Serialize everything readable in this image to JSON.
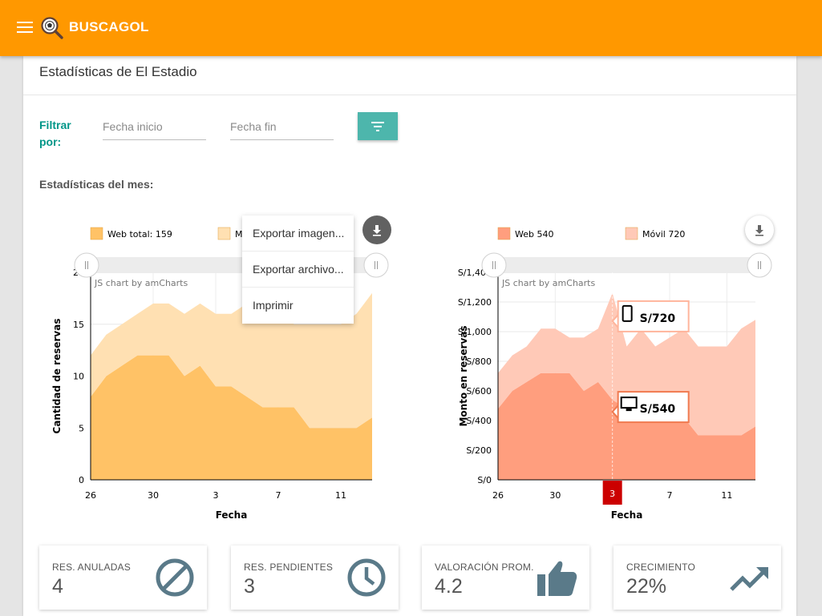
{
  "app": {
    "title": "BUSCAGOL"
  },
  "page": {
    "title": "Estadísticas de El Estadio"
  },
  "filter": {
    "label": "Filtrar por:",
    "start_placeholder": "Fecha inicio",
    "end_placeholder": "Fecha fin",
    "button_icon": "filter-list-icon"
  },
  "section": {
    "label": "Estadísticas del mes:"
  },
  "export_menu": {
    "items": [
      "Exportar imagen...",
      "Exportar archivo...",
      "Imprimir"
    ]
  },
  "colors": {
    "brand": "#ff9800",
    "accent": "#009688",
    "filter_button": "#4db6ac",
    "chart1_web": "#ffc266",
    "chart1_movil": "#ffe0b2",
    "chart2_web": "#ff9e7e",
    "chart2_movil": "#ffc9b7",
    "kpi_icon": "#5a7a89",
    "cursor_label": "#cc0000"
  },
  "chart_data": [
    {
      "type": "area",
      "stacked": true,
      "watermark": "JS chart by amCharts",
      "xlabel": "Fecha",
      "ylabel": "Cantidad de reservas",
      "ylim": [
        0,
        20
      ],
      "yticks": [
        "0",
        "5",
        "10",
        "15",
        "20"
      ],
      "x_ticks": [
        {
          "label": "26",
          "index": 0
        },
        {
          "label": "30",
          "index": 4
        },
        {
          "label": "3",
          "index": 8
        },
        {
          "label": "7",
          "index": 12
        },
        {
          "label": "11",
          "index": 16
        }
      ],
      "n_points": 19,
      "legend": [
        {
          "label": "Web total: 159",
          "color": "#ffc266"
        },
        {
          "label": "M",
          "color": "#ffe0b2"
        }
      ],
      "series": [
        {
          "name": "Web total",
          "values": [
            8,
            10,
            11,
            12,
            12,
            12,
            10,
            11,
            9,
            9,
            8,
            7,
            7,
            7,
            5,
            5,
            5,
            5,
            6
          ]
        },
        {
          "name": "",
          "values": [
            4,
            4,
            4,
            4,
            5,
            5,
            6,
            6,
            7,
            7,
            9,
            9,
            10,
            8,
            10,
            10,
            10,
            11,
            12
          ]
        }
      ],
      "grid": true
    },
    {
      "type": "area",
      "stacked": true,
      "watermark": "JS chart by amCharts",
      "xlabel": "Fecha",
      "ylabel": "Monto en reservas",
      "ylim": [
        0,
        1400
      ],
      "yticks": [
        "S/0",
        "S/200",
        "S/400",
        "S/600",
        "S/800",
        "S/1,000",
        "S/1,200",
        "S/1,400"
      ],
      "x_ticks": [
        {
          "label": "26",
          "index": 0
        },
        {
          "label": "30",
          "index": 4
        },
        {
          "label": "7",
          "index": 12
        },
        {
          "label": "11",
          "index": 16
        }
      ],
      "n_points": 19,
      "cursor": {
        "index": 8,
        "label": "3"
      },
      "legend": [
        {
          "label": "Web 540",
          "color": "#ff9e7e"
        },
        {
          "label": "Móvil 720",
          "color": "#ffc9b7"
        }
      ],
      "series": [
        {
          "name": "Web",
          "values": [
            480,
            600,
            660,
            720,
            720,
            720,
            600,
            660,
            540,
            480,
            480,
            480,
            420,
            420,
            300,
            300,
            300,
            300,
            360
          ]
        },
        {
          "name": "Móvil",
          "values": [
            240,
            240,
            240,
            300,
            300,
            240,
            360,
            360,
            720,
            420,
            540,
            420,
            540,
            600,
            600,
            600,
            600,
            720,
            720
          ]
        }
      ],
      "tooltips": [
        {
          "label": "S/720",
          "icon": "smartphone-icon"
        },
        {
          "label": "S/540",
          "icon": "desktop-icon"
        }
      ],
      "grid": true
    }
  ],
  "kpis": [
    {
      "label": "RES. ANULADAS",
      "value": "4",
      "icon": "block-icon"
    },
    {
      "label": "RES. PENDIENTES",
      "value": "3",
      "icon": "clock-icon"
    },
    {
      "label": "VALORACIÓN PROM.",
      "value": "4.2",
      "icon": "thumb-up-icon"
    },
    {
      "label": "CRECIMIENTO",
      "value": "22%",
      "icon": "trending-up-icon"
    }
  ]
}
